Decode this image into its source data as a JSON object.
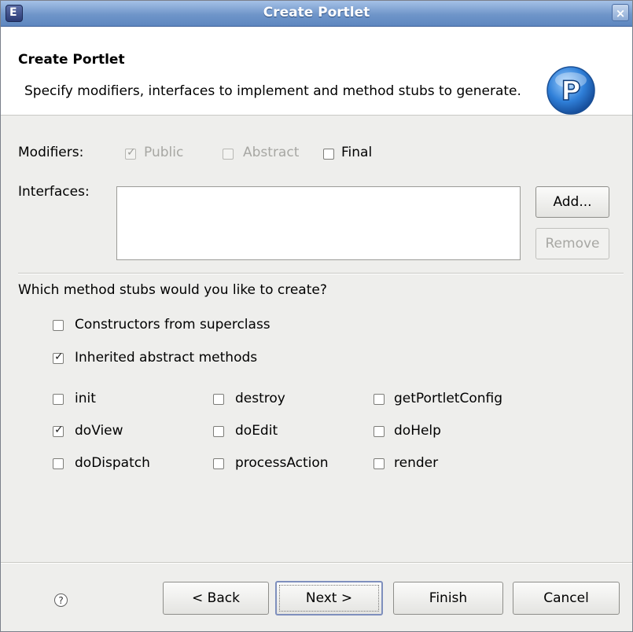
{
  "window": {
    "title": "Create Portlet",
    "close_glyph": "×",
    "app_icon_glyph": "E"
  },
  "banner": {
    "title": "Create Portlet",
    "description": "Specify modifiers, interfaces to implement and method stubs to generate.",
    "logo_letter": "P"
  },
  "modifiers": {
    "label": "Modifiers:",
    "public": {
      "label": "Public",
      "checked": true,
      "enabled": false
    },
    "abstract": {
      "label": "Abstract",
      "checked": false,
      "enabled": false
    },
    "final": {
      "label": "Final",
      "checked": false,
      "enabled": true
    }
  },
  "interfaces": {
    "label": "Interfaces:",
    "add_label": "Add...",
    "remove_label": "Remove"
  },
  "stubs": {
    "question": "Which method stubs would you like to create?",
    "constructors": {
      "label": "Constructors from superclass",
      "checked": false
    },
    "inherited": {
      "label": "Inherited abstract methods",
      "checked": true
    }
  },
  "methods": {
    "init": {
      "label": "init",
      "checked": false
    },
    "destroy": {
      "label": "destroy",
      "checked": false
    },
    "getPortletConfig": {
      "label": "getPortletConfig",
      "checked": false
    },
    "doView": {
      "label": "doView",
      "checked": true
    },
    "doEdit": {
      "label": "doEdit",
      "checked": false
    },
    "doHelp": {
      "label": "doHelp",
      "checked": false
    },
    "doDispatch": {
      "label": "doDispatch",
      "checked": false
    },
    "processAction": {
      "label": "processAction",
      "checked": false
    },
    "render": {
      "label": "render",
      "checked": false
    }
  },
  "footer": {
    "help_glyph": "?",
    "back_label": "< Back",
    "next_label": "Next >",
    "finish_label": "Finish",
    "cancel_label": "Cancel"
  },
  "colors": {
    "titlebar": "#6f95c9",
    "dialog_bg": "#eeeeec",
    "logo_blue": "#2f7fd8"
  },
  "icons": [
    "app-icon",
    "close-icon",
    "portlet-logo-icon",
    "checkmark-icon",
    "help-icon"
  ]
}
